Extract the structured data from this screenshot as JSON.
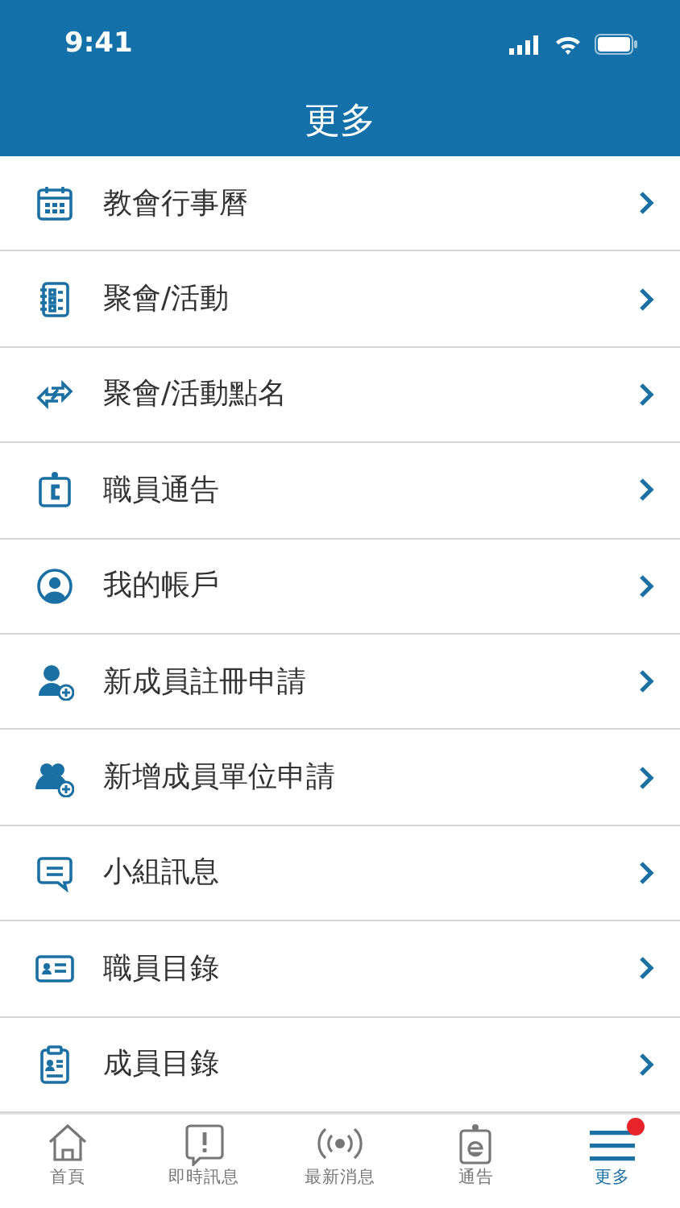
{
  "status_bar": {
    "time": "9:41"
  },
  "header": {
    "title": "更多"
  },
  "menu": [
    {
      "label": "教會行事曆"
    },
    {
      "label": "聚會/活動"
    },
    {
      "label": "聚會/活動點名"
    },
    {
      "label": "職員通告"
    },
    {
      "label": "我的帳戶"
    },
    {
      "label": "新成員註冊申請"
    },
    {
      "label": "新增成員單位申請"
    },
    {
      "label": "小組訊息"
    },
    {
      "label": "職員目錄"
    },
    {
      "label": "成員目錄"
    }
  ],
  "tab_bar": [
    {
      "label": "首頁",
      "selected": false,
      "badge": false
    },
    {
      "label": "即時訊息",
      "selected": false,
      "badge": false
    },
    {
      "label": "最新消息",
      "selected": false,
      "badge": false
    },
    {
      "label": "通告",
      "selected": false,
      "badge": false
    },
    {
      "label": "更多",
      "selected": true,
      "badge": true
    }
  ]
}
